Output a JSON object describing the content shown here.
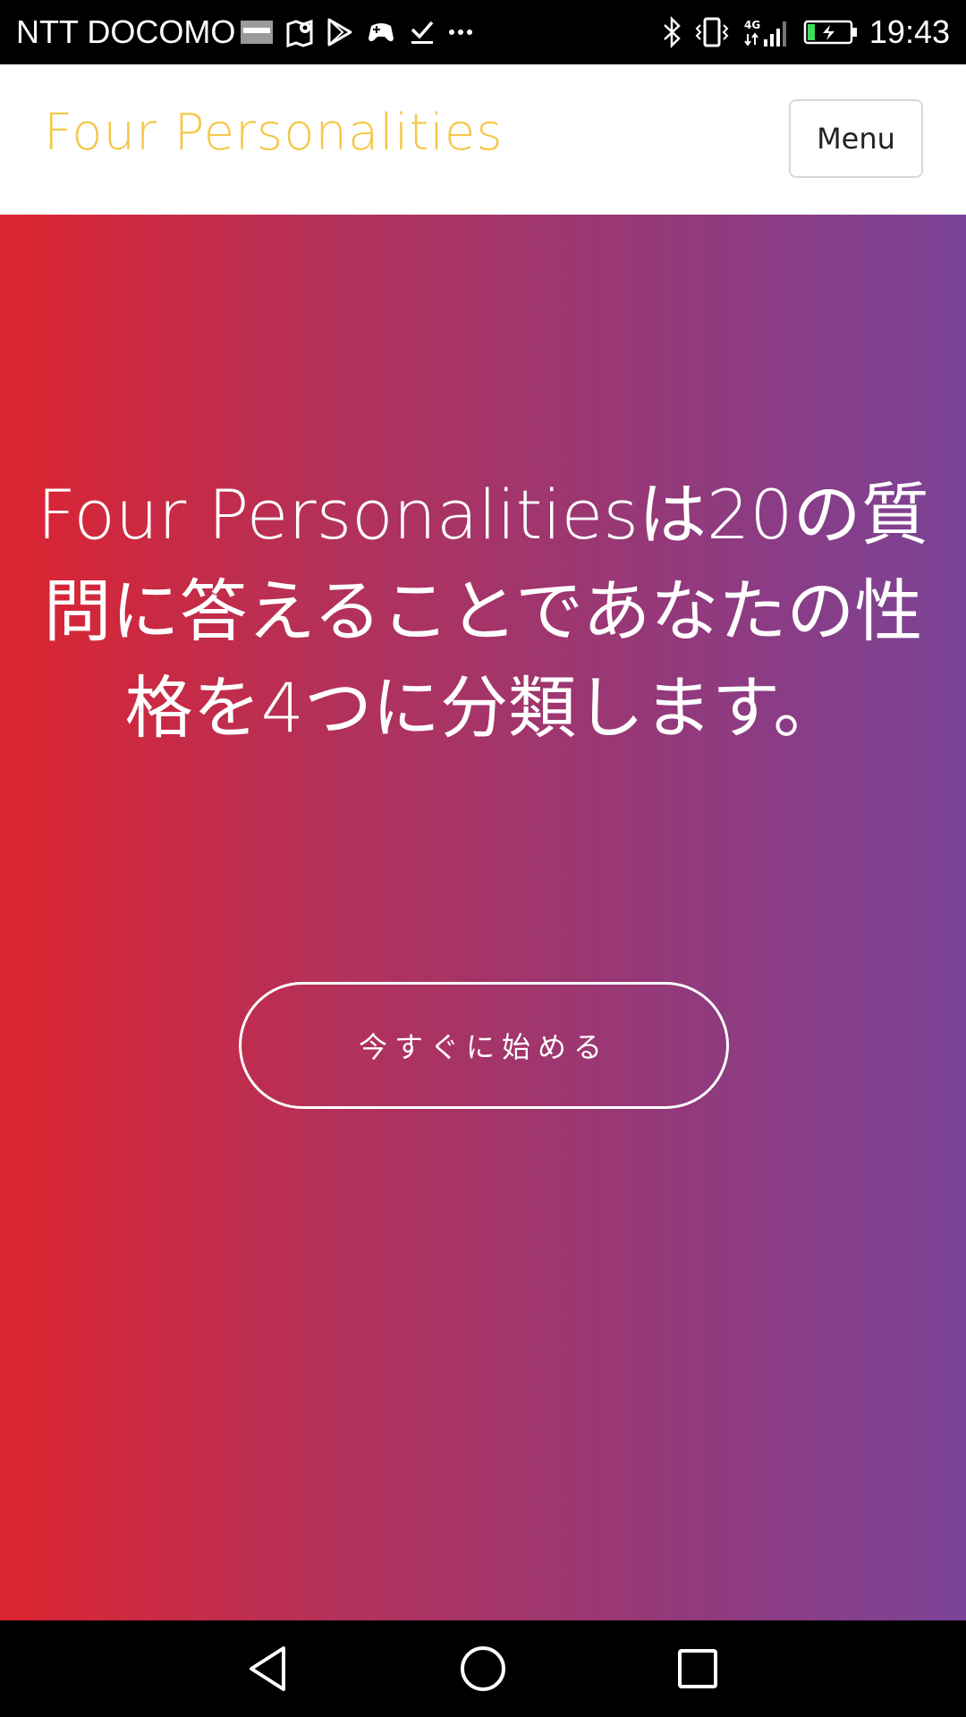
{
  "status_bar": {
    "carrier": "NTT DOCOMO",
    "time": "19:43",
    "network": "4G",
    "icons_left": [
      "yahoo-notification-icon",
      "maps-icon",
      "play-store-icon",
      "game-controller-icon",
      "download-done-icon",
      "more-icon"
    ],
    "icons_right": [
      "bluetooth-icon",
      "vibrate-icon",
      "signal-icon",
      "battery-charging-icon"
    ]
  },
  "header": {
    "brand": "Four Personalities",
    "brand_color": "#f5c84b",
    "menu_label": "Menu"
  },
  "hero": {
    "title": "Four Personalitiesは20の質問に答えることであなたの性格を4つに分類します。",
    "cta_label": "今すぐに始める",
    "gradient": [
      "#dc2430",
      "#7b4397"
    ]
  },
  "nav_bar": {
    "buttons": [
      "back-icon",
      "home-icon",
      "recents-icon"
    ]
  }
}
